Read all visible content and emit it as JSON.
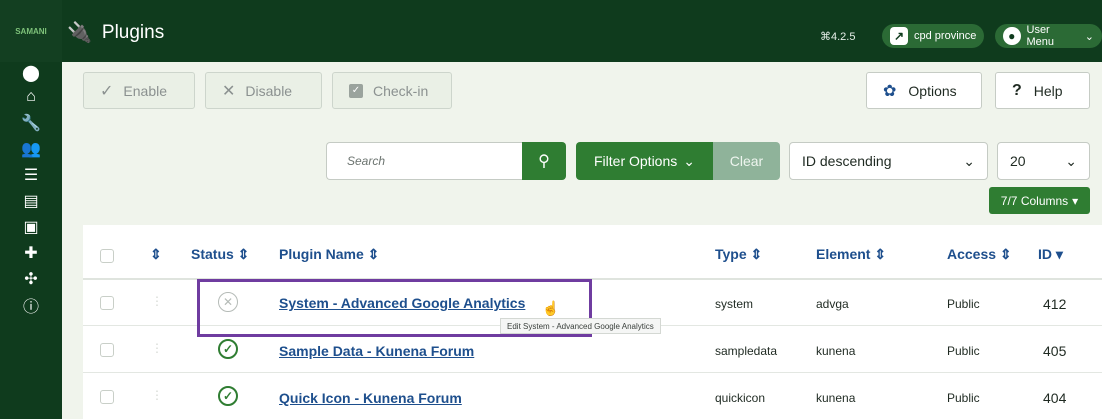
{
  "header": {
    "brand_text": "SAMANI",
    "title": "Plugins",
    "version": "⌘4.2.5",
    "site_label": "cpd province",
    "user_menu_label": "User Menu"
  },
  "toolbar": {
    "enable": "Enable",
    "disable": "Disable",
    "checkin": "Check-in",
    "options": "Options",
    "help": "Help"
  },
  "filters": {
    "search_placeholder": "Search",
    "filter_options": "Filter Options",
    "clear": "Clear",
    "sort": "ID descending",
    "limit": "20",
    "columns": "7/7 Columns"
  },
  "table": {
    "headers": {
      "status": "Status ⇕",
      "plugin_name": "Plugin Name ⇕",
      "type": "Type ⇕",
      "element": "Element ⇕",
      "access": "Access ⇕",
      "id": "ID ▾",
      "order": "⇕"
    },
    "rows": [
      {
        "status": "disabled",
        "name": "System - Advanced Google Analytics",
        "type": "system",
        "element": "advga",
        "access": "Public",
        "id": "412"
      },
      {
        "status": "enabled",
        "name": "Sample Data - Kunena Forum",
        "type": "sampledata",
        "element": "kunena",
        "access": "Public",
        "id": "405"
      },
      {
        "status": "enabled",
        "name": "Quick Icon - Kunena Forum",
        "type": "quickicon",
        "element": "kunena",
        "access": "Public",
        "id": "404"
      }
    ]
  },
  "tooltip": "Edit System - Advanced Google Analytics",
  "colors": {
    "header_bg": "#0f3b1d",
    "accent_green": "#2f7d32",
    "link_blue": "#1e4f8d",
    "highlight_purple": "#6f3ca0"
  }
}
